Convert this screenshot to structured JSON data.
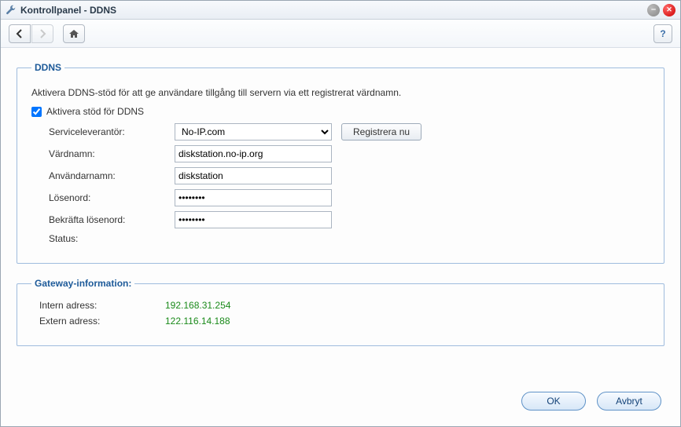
{
  "window": {
    "title": "Kontrollpanel - DDNS"
  },
  "ddns": {
    "legend": "DDNS",
    "description": "Aktivera DDNS-stöd för att ge användare tillgång till servern via ett registrerat värdnamn.",
    "enable_label": "Aktivera stöd för DDNS",
    "provider_label": "Serviceleverantör:",
    "provider_value": "No-IP.com",
    "register_label": "Registrera nu",
    "hostname_label": "Värdnamn:",
    "hostname_value": "diskstation.no-ip.org",
    "username_label": "Användarnamn:",
    "username_value": "diskstation",
    "password_label": "Lösenord:",
    "password_value": "••••••••",
    "confirm_label": "Bekräfta lösenord:",
    "confirm_value": "••••••••",
    "status_label": "Status:",
    "status_value": ""
  },
  "gateway": {
    "legend": "Gateway-information:",
    "internal_label": "Intern adress:",
    "internal_value": "192.168.31.254",
    "external_label": "Extern adress:",
    "external_value": "122.116.14.188"
  },
  "buttons": {
    "ok": "OK",
    "cancel": "Avbryt"
  }
}
